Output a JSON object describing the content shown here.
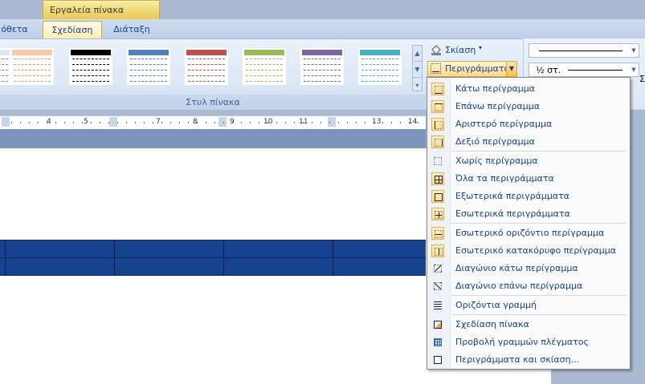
{
  "contextual_tab": {
    "title": "Εργαλεία πίνακα"
  },
  "tabs": {
    "insert": "όθετα",
    "design": "Σχεδίαση",
    "layout": "Διάταξη"
  },
  "ribbon": {
    "styles_group_label": "Στυλ πίνακα",
    "table_styles": [
      {
        "name": "style-orange",
        "header": "#f7c9a4",
        "lines": "#f29b57"
      },
      {
        "name": "style-black",
        "header": "#000000",
        "lines": "#000000"
      },
      {
        "name": "style-blue",
        "header": "#4f81bd",
        "lines": "#4f81bd"
      },
      {
        "name": "style-red",
        "header": "#c0504d",
        "lines": "#c0504d"
      },
      {
        "name": "style-green",
        "header": "#9bbb59",
        "lines": "#9bbb59"
      },
      {
        "name": "style-purple",
        "header": "#8064a2",
        "lines": "#8064a2"
      },
      {
        "name": "style-aqua",
        "header": "#4bacc6",
        "lines": "#4bacc6"
      }
    ],
    "shading_label": "Σκίαση",
    "borders_label": "Περιγράμματα",
    "line_weight_label": "½ στ.",
    "draw_extra_label": "Σ"
  },
  "ruler": {
    "numbers": [
      "4",
      "5",
      "7",
      "8",
      "9",
      "10",
      "11",
      "13",
      "14"
    ]
  },
  "borders_menu": {
    "items": [
      {
        "label": "Κάτω περίγραμμα",
        "icon": "bottom-border-icon",
        "highlight": true
      },
      {
        "label": "Επάνω περίγραμμα",
        "icon": "top-border-icon",
        "highlight": true
      },
      {
        "label": "Αριστερό περίγραμμα",
        "icon": "left-border-icon",
        "highlight": true
      },
      {
        "label": "Δεξιό περίγραμμα",
        "icon": "right-border-icon",
        "highlight": true
      },
      {
        "label": "Χωρίς περίγραμμα",
        "icon": "no-border-icon",
        "highlight": false
      },
      {
        "label": "Όλα τα περιγράμματα",
        "icon": "all-borders-icon",
        "highlight": true
      },
      {
        "label": "Εξωτερικά περιγράμματα",
        "icon": "outside-borders-icon",
        "highlight": true
      },
      {
        "label": "Εσωτερικά περιγράμματα",
        "icon": "inside-borders-icon",
        "highlight": true
      },
      {
        "label": "Εσωτερικό οριζόντιο περίγραμμα",
        "icon": "inside-horizontal-border-icon",
        "highlight": true
      },
      {
        "label": "Εσωτερικό κατακόρυφο περίγραμμα",
        "icon": "inside-vertical-border-icon",
        "highlight": true
      },
      {
        "label": "Διαγώνιο κάτω περίγραμμα",
        "icon": "diagonal-down-border-icon",
        "highlight": false
      },
      {
        "label": "Διαγώνιο επάνω περίγραμμα",
        "icon": "diagonal-up-border-icon",
        "highlight": false
      },
      {
        "label": "Οριζόντια γραμμή",
        "icon": "horizontal-line-icon",
        "highlight": false
      },
      {
        "label": "Σχεδίαση πίνακα",
        "icon": "draw-table-icon",
        "highlight": false
      },
      {
        "label": "Προβολή γραμμών πλέγματος",
        "icon": "view-gridlines-icon",
        "highlight": false
      },
      {
        "label": "Περιγράμματα και σκίαση...",
        "icon": "borders-and-shading-icon",
        "highlight": false
      }
    ]
  }
}
